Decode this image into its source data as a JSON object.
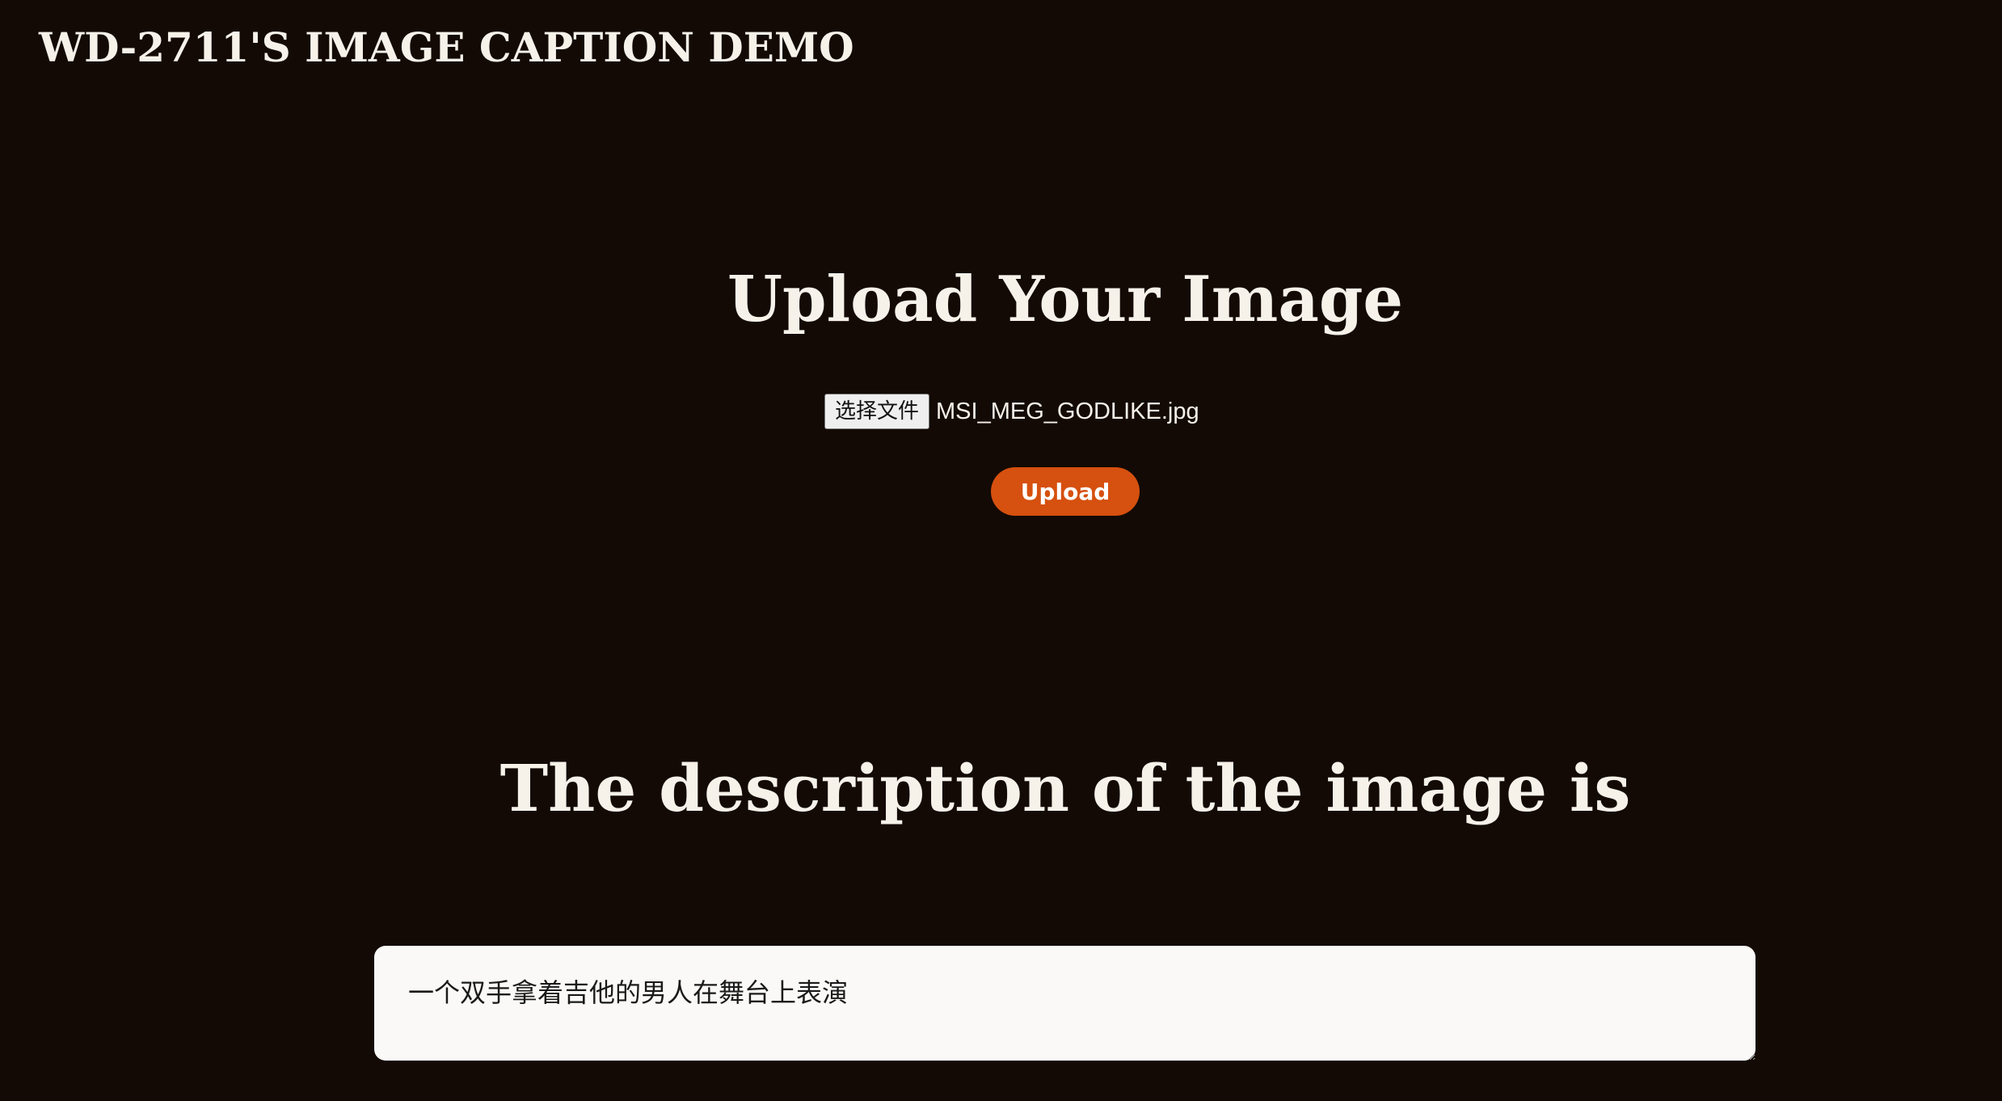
{
  "header": {
    "title": "WD-2711'S IMAGE CAPTION DEMO"
  },
  "upload": {
    "heading": "Upload Your Image",
    "choose_file_label": "选择文件",
    "selected_file": "MSI_MEG_GODLIKE.jpg",
    "upload_button_label": "Upload"
  },
  "result": {
    "heading": "The description of the image is",
    "caption": "一个双手拿着吉他的男人在舞台上表演"
  },
  "colors": {
    "background": "#130a05",
    "accent": "#d6500f",
    "text": "#f6f2ea"
  }
}
